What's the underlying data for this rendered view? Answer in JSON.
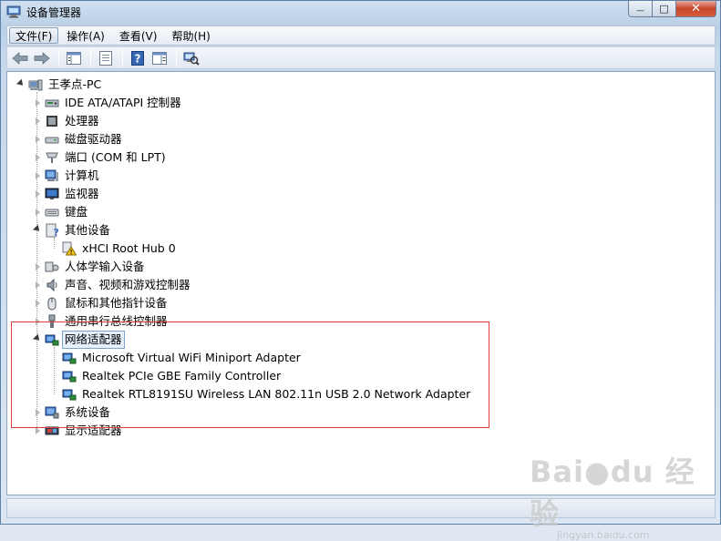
{
  "window": {
    "title": "设备管理器",
    "controls": {
      "minimize": "—",
      "maximize": "□",
      "close": "✕"
    }
  },
  "menu": [
    {
      "label": "文件(F)",
      "active": true
    },
    {
      "label": "操作(A)",
      "active": false
    },
    {
      "label": "查看(V)",
      "active": false
    },
    {
      "label": "帮助(H)",
      "active": false
    }
  ],
  "toolbar": [
    {
      "icon": "back-arrow-icon"
    },
    {
      "icon": "forward-arrow-icon"
    },
    {
      "icon": "show-hide-console-tree-icon"
    },
    {
      "icon": "properties-icon"
    },
    {
      "icon": "help-icon"
    },
    {
      "icon": "action-pane-icon"
    },
    {
      "icon": "scan-hardware-icon"
    }
  ],
  "tree": {
    "root": {
      "label": "王孝点-PC",
      "icon": "computer-icon"
    },
    "categories": [
      {
        "label": "IDE ATA/ATAPI 控制器",
        "icon": "ide-controller-icon"
      },
      {
        "label": "处理器",
        "icon": "processor-icon"
      },
      {
        "label": "磁盘驱动器",
        "icon": "disk-drive-icon"
      },
      {
        "label": "端口 (COM 和 LPT)",
        "icon": "port-icon"
      },
      {
        "label": "计算机",
        "icon": "computer-icon"
      },
      {
        "label": "监视器",
        "icon": "monitor-icon"
      },
      {
        "label": "键盘",
        "icon": "keyboard-icon"
      },
      {
        "label": "其他设备",
        "icon": "unknown-device-icon",
        "expanded": true,
        "children": [
          {
            "label": "xHCI Root Hub 0",
            "icon": "warning-device-icon"
          }
        ]
      },
      {
        "label": "人体学输入设备",
        "icon": "hid-icon"
      },
      {
        "label": "声音、视频和游戏控制器",
        "icon": "speaker-icon"
      },
      {
        "label": "鼠标和其他指针设备",
        "icon": "mouse-icon"
      },
      {
        "label": "通用串行总线控制器",
        "icon": "usb-icon"
      },
      {
        "label": "网络适配器",
        "icon": "network-adapter-icon",
        "expanded": true,
        "selected": true,
        "children": [
          {
            "label": "Microsoft Virtual WiFi Miniport Adapter",
            "icon": "network-adapter-icon"
          },
          {
            "label": "Realtek PCIe GBE Family Controller",
            "icon": "network-adapter-icon"
          },
          {
            "label": "Realtek RTL8191SU Wireless LAN 802.11n USB 2.0 Network Adapter",
            "icon": "network-adapter-icon"
          }
        ]
      },
      {
        "label": "系统设备",
        "icon": "system-device-icon"
      },
      {
        "label": "显示适配器",
        "icon": "display-adapter-icon"
      }
    ]
  },
  "watermark": {
    "brand": "Bai●du 经验",
    "url": "jingyan.baidu.com"
  },
  "colors": {
    "highlight_box": "#e03c3c",
    "selection": "#e5f0fb"
  }
}
